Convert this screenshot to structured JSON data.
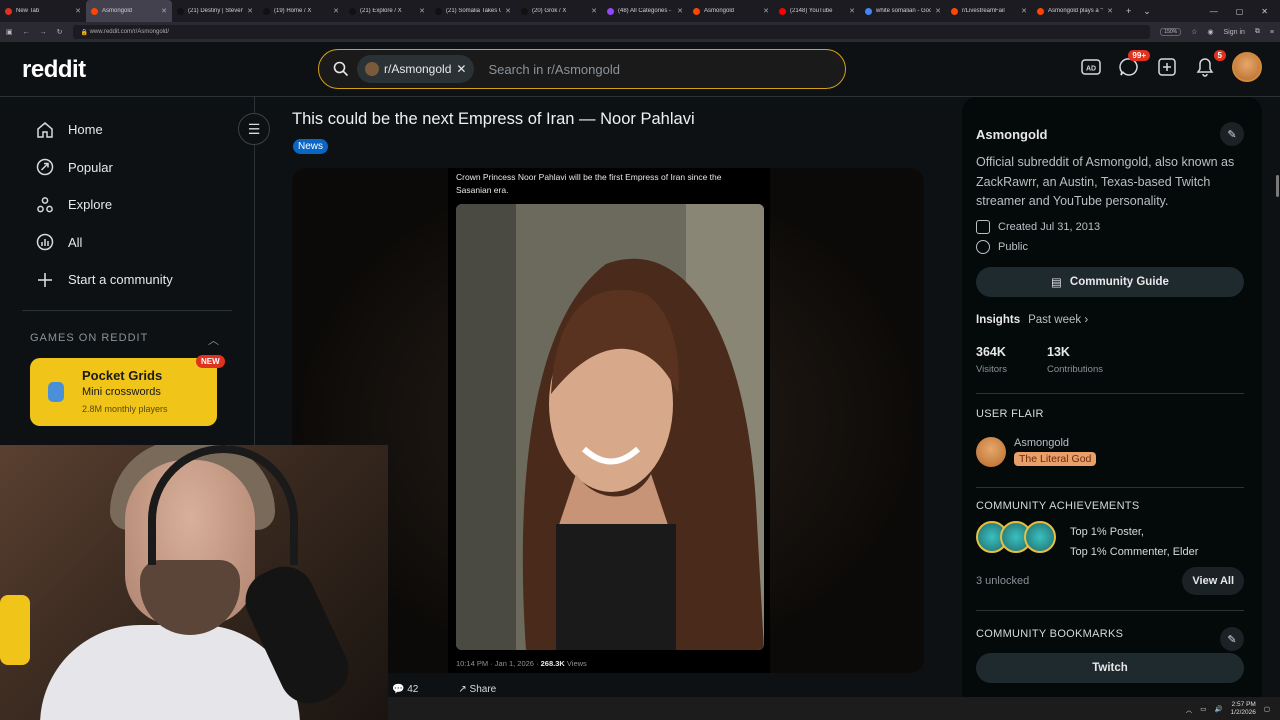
{
  "browser": {
    "tabs": [
      {
        "title": "New Tab",
        "color": "#e0321f"
      },
      {
        "title": "Asmongold",
        "color": "#ff4500",
        "active": true
      },
      {
        "title": "(21) Destiny | Steven B",
        "color": "#111111"
      },
      {
        "title": "(19) Home / X",
        "color": "#111111"
      },
      {
        "title": "(21) Explore / X",
        "color": "#111111"
      },
      {
        "title": "(21) Somalia Takes US",
        "color": "#111111"
      },
      {
        "title": "(20) Grok / X",
        "color": "#111111"
      },
      {
        "title": "(48) All Categories - T",
        "color": "#9146ff"
      },
      {
        "title": "Asmongold",
        "color": "#ff4500"
      },
      {
        "title": "(2148) YouTube",
        "color": "#ff0000"
      },
      {
        "title": "white somalian - Goo",
        "color": "#4285f4"
      },
      {
        "title": "r/LivestreamFail",
        "color": "#ff4500"
      },
      {
        "title": "Asmongold plays a \"v",
        "color": "#ff4500"
      }
    ],
    "url": "www.reddit.com/r/Asmongold/",
    "zoom": "150%",
    "sign_in": "Sign in"
  },
  "header": {
    "logo": "reddit",
    "search_chip": "r/Asmongold",
    "search_placeholder": "Search in r/Asmongold",
    "chat_badge": "99+",
    "notif_badge": "5"
  },
  "sidebar": {
    "items": [
      {
        "label": "Home",
        "icon": "home-icon"
      },
      {
        "label": "Popular",
        "icon": "popular-icon"
      },
      {
        "label": "Explore",
        "icon": "explore-icon"
      },
      {
        "label": "All",
        "icon": "all-icon"
      },
      {
        "label": "Start a community",
        "icon": "plus-icon"
      }
    ],
    "games_header": "GAMES ON REDDIT",
    "game": {
      "title": "Pocket Grids",
      "subtitle": "Mini crosswords",
      "players": "2.8M monthly players",
      "badge": "NEW"
    }
  },
  "post": {
    "title": "This could be the next Empress of Iran — Noor Pahlavi",
    "flair": "News",
    "tweet_text": "Crown Princess Noor Pahlavi will be the first Empress of Iran since the Sasanian era.",
    "tweet_time": "10:14 PM · Jan 1, 2026 · ",
    "tweet_views_num": "268.3K",
    "tweet_views_label": " Views",
    "comments": "42",
    "share": "Share"
  },
  "community": {
    "name": "Asmongold",
    "description": "Official subreddit of Asmongold, also known as ZackRawrr, an Austin, Texas-based Twitch streamer and YouTube personality.",
    "created": "Created Jul 31, 2013",
    "visibility": "Public",
    "guide_button": "Community Guide",
    "insights_label": "Insights",
    "insights_period": "Past week",
    "visitors_value": "364K",
    "visitors_label": "Visitors",
    "contrib_value": "13K",
    "contrib_label": "Contributions",
    "user_flair_header": "USER FLAIR",
    "flair_user": "Asmongold",
    "flair_tag": "The Literal God",
    "achievements_header": "COMMUNITY ACHIEVEMENTS",
    "achievements_line1": "Top 1% Poster,",
    "achievements_line2": "Top 1% Commenter, Elder",
    "unlocked": "3 unlocked",
    "view_all": "View All",
    "bookmarks_header": "COMMUNITY BOOKMARKS",
    "bookmark_1": "Twitch"
  },
  "taskbar": {
    "time": "2:57 PM",
    "date": "1/2/2026"
  }
}
